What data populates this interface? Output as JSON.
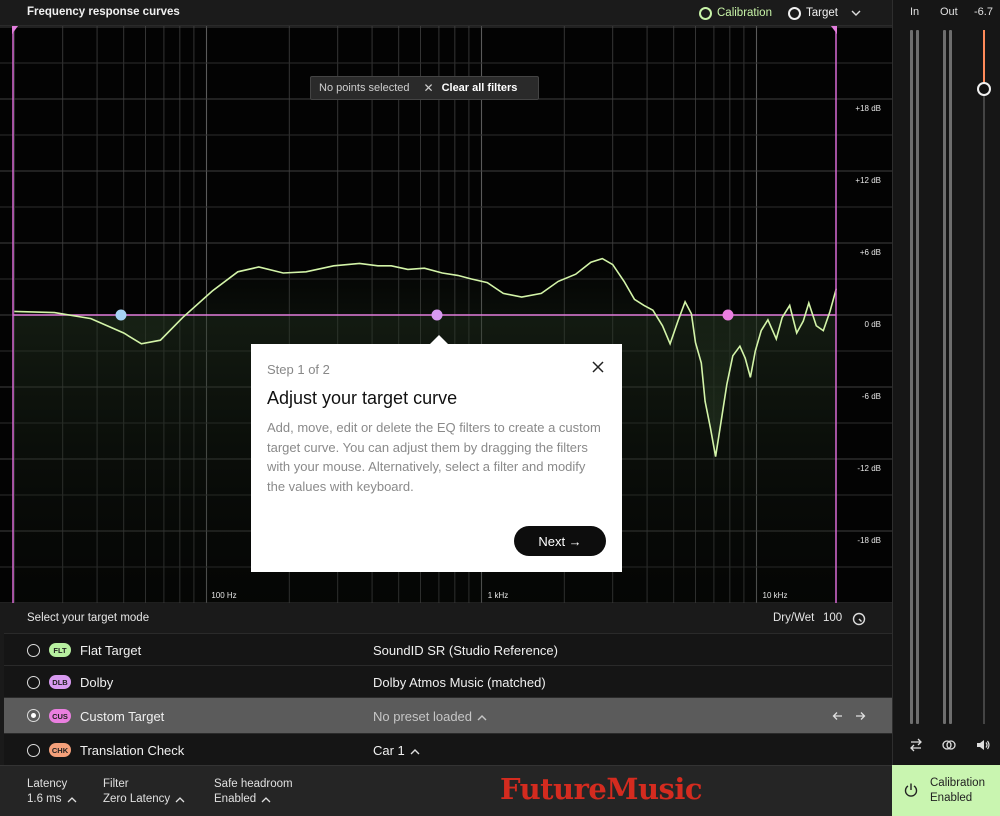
{
  "header": {
    "title": "Frequency response curves",
    "legend_calibration": "Calibration",
    "legend_target": "Target",
    "calibration_color": "#c8f4a8",
    "target_color": "#f0f0f0"
  },
  "graph": {
    "freq_labels": [
      "100 Hz",
      "1 kHz",
      "10 kHz"
    ],
    "db_labels": [
      "+18 dB",
      "+12 dB",
      "+6 dB",
      "0 dB",
      "-6 dB",
      "-12 dB",
      "-18 dB"
    ],
    "curve_color": "#d3f4a8",
    "target_line_color": "#e27ddc",
    "filter_point_colors": [
      "#a7d3f5",
      "#d79af0",
      "#ea7fe0"
    ],
    "selection": {
      "status": "No points selected",
      "clear_label": "Clear all filters"
    }
  },
  "popover": {
    "step": "Step 1 of 2",
    "title": "Adjust your target curve",
    "body": "Add, move, edit or delete the EQ filters to create a custom target curve. You can adjust them by dragging the filters with your mouse. Alternatively, select a filter and modify the values with keyboard.",
    "next_label": "Next →"
  },
  "target_mode": {
    "label": "Select your target mode",
    "drywet_label": "Dry/Wet",
    "drywet_value": "100",
    "rows": [
      {
        "badge": "FLT",
        "badge_color": "#b8f0a0",
        "name": "Flat Target",
        "preset": "SoundID SR (Studio Reference)"
      },
      {
        "badge": "DLB",
        "badge_color": "#d79af0",
        "name": "Dolby",
        "preset": "Dolby Atmos Music (matched)"
      },
      {
        "badge": "CUS",
        "badge_color": "#ea7fe0",
        "name": "Custom Target",
        "preset": "No preset loaded"
      },
      {
        "badge": "CHK",
        "badge_color": "#f4a07a",
        "name": "Translation Check",
        "preset": "Car 1"
      }
    ]
  },
  "footer": {
    "latency_label": "Latency",
    "latency_value": "1.6 ms",
    "filter_label": "Filter",
    "filter_value": "Zero Latency",
    "headroom_label": "Safe headroom",
    "headroom_value": "Enabled",
    "brand": "FutureMusic"
  },
  "meters": {
    "in_label": "In",
    "out_label": "Out",
    "output_value": "-6.7",
    "output_slider_color": "#ff8a5a"
  },
  "status": {
    "calibration_line1": "Calibration",
    "calibration_line2": "Enabled",
    "calibration_bg": "#c9f5b0"
  }
}
